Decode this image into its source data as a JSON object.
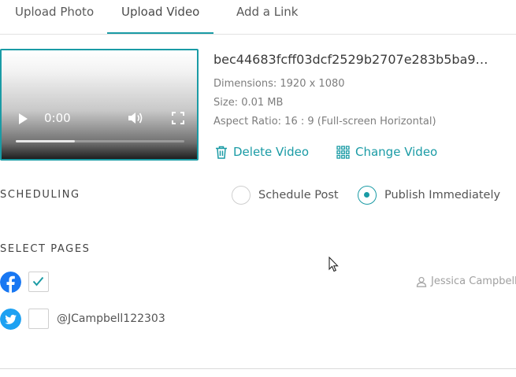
{
  "tabs": [
    {
      "label": "Upload Photo",
      "active": false
    },
    {
      "label": "Upload Video",
      "active": true
    },
    {
      "label": "Add a Link",
      "active": false
    }
  ],
  "player": {
    "time": "0:00",
    "progress": 0.35
  },
  "file": {
    "name": "bec44683fcff03dcf2529b2707e283b5ba9…",
    "dimensions": "Dimensions: 1920 x 1080",
    "size": "Size: 0.01 MB",
    "aspect": "Aspect Ratio: 16 : 9 (Full-screen Horizontal)"
  },
  "actions": {
    "delete": "Delete Video",
    "change": "Change Video"
  },
  "scheduling": {
    "title": "SCHEDULING",
    "options": [
      {
        "label": "Schedule Post",
        "selected": false
      },
      {
        "label": "Publish Immediately",
        "selected": true
      }
    ]
  },
  "pages": {
    "title": "SELECT PAGES",
    "facebook": {
      "checked": true,
      "user": "Jessica Campbell"
    },
    "twitter": {
      "checked": false,
      "handle": "@JCampbell122303"
    }
  },
  "colors": {
    "accent": "#1a9ba5",
    "facebook": "#1877f2",
    "twitter": "#1da1f2"
  }
}
